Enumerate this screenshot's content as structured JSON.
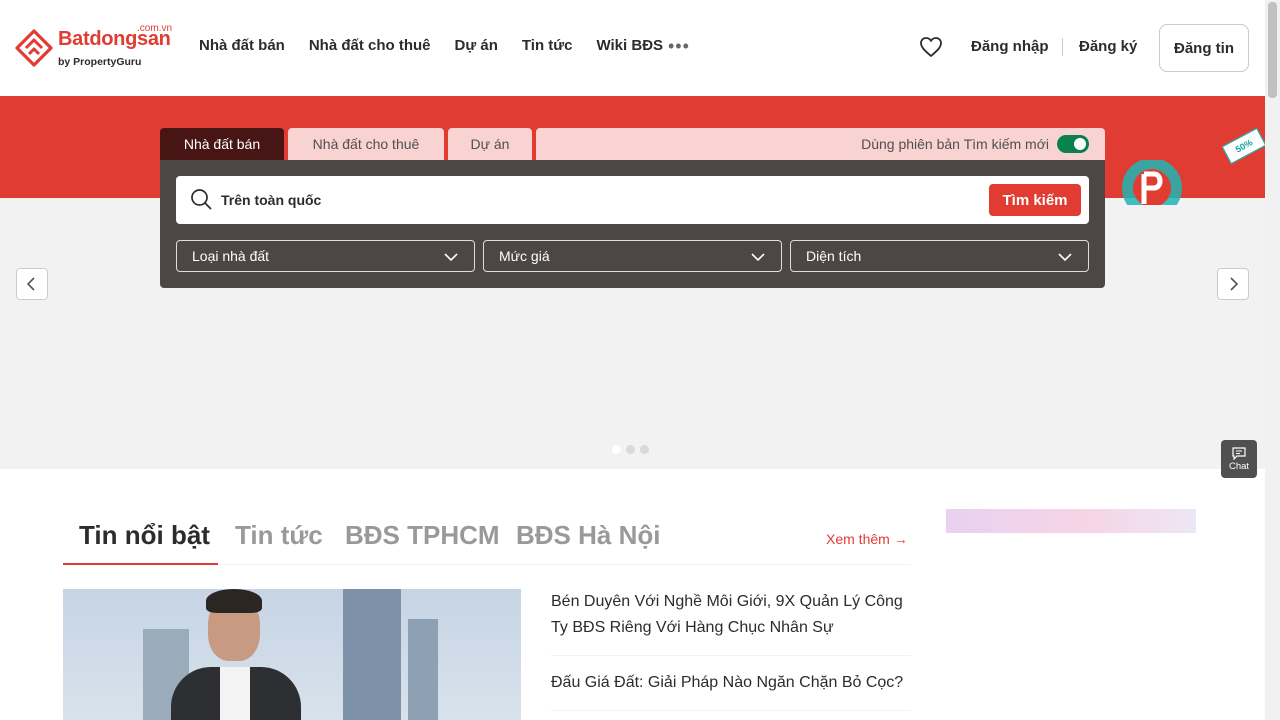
{
  "header": {
    "logo_brand": "Batdongsan",
    "logo_tld": ".com.vn",
    "logo_sub": "by PropertyGuru",
    "nav": [
      "Nhà đất bán",
      "Nhà đất cho thuê",
      "Dự án",
      "Tin tức",
      "Wiki BĐS"
    ],
    "more_icon": "more-horizontal-icon",
    "favorite_icon": "heart-icon",
    "login": "Đăng nhập",
    "register": "Đăng ký",
    "post": "Đăng tin",
    "brand_color": "#e03c31"
  },
  "search": {
    "tabs": [
      "Nhà đất bán",
      "Nhà đất cho thuê",
      "Dự án"
    ],
    "new_version_label": "Dùng phiên bản Tìm kiếm mới",
    "new_version_enabled": true,
    "location": "Trên toàn quốc",
    "search_button": "Tìm kiếm",
    "filters": [
      "Loại nhà đất",
      "Mức giá",
      "Diện tích"
    ]
  },
  "hero": {
    "promo_tag": "50%",
    "slide_count": 3,
    "active_slide": 1
  },
  "chat": {
    "label": "Chat"
  },
  "news": {
    "tabs": [
      "Tin nổi bật",
      "Tin tức",
      "BĐS TPHCM",
      "BĐS Hà Nội"
    ],
    "see_more": "Xem thêm",
    "items": [
      "Bén Duyên Với Nghề Môi Giới, 9X Quản Lý Công Ty BĐS Riêng Với Hàng Chục Nhân Sự",
      "Đấu Giá Đất: Giải Pháp Nào Ngăn Chặn Bỏ Cọc?"
    ]
  }
}
